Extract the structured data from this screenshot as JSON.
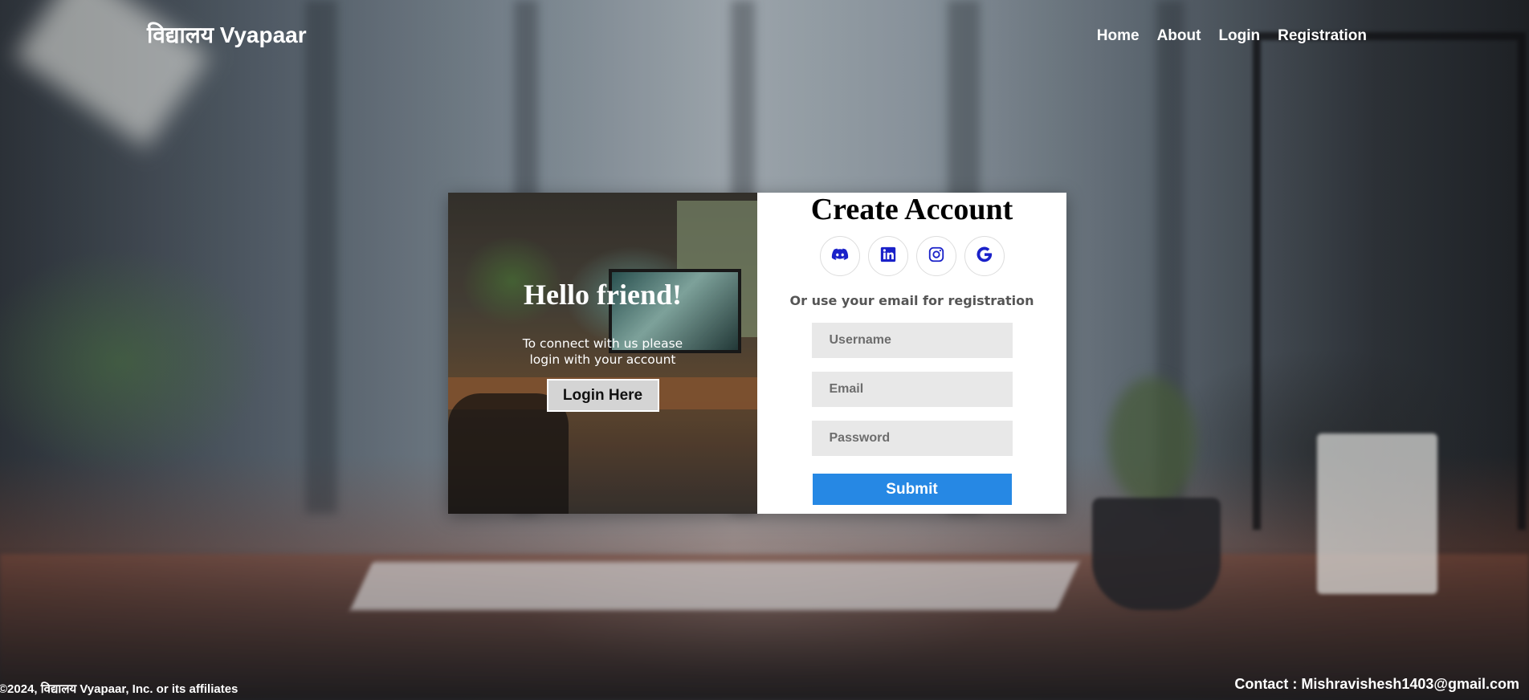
{
  "brand": {
    "name": "विद्यालय Vyapaar"
  },
  "nav": {
    "items": [
      {
        "label": "Home"
      },
      {
        "label": "About"
      },
      {
        "label": "Login"
      },
      {
        "label": "Registration"
      }
    ]
  },
  "welcome_panel": {
    "heading": "Hello friend!",
    "message": "To connect with us please login with your account",
    "login_button_label": "Login Here"
  },
  "register_form": {
    "title": "Create Account",
    "social_icons": [
      "discord-icon",
      "linkedin-icon",
      "instagram-icon",
      "google-icon"
    ],
    "alt_text": "Or use your email for registration",
    "username_placeholder": "Username",
    "email_placeholder": "Email",
    "password_placeholder": "Password",
    "submit_label": "Submit"
  },
  "footer": {
    "copyright": "©2024, विद्यालय Vyapaar, Inc. or its affiliates",
    "contact": "Contact : Mishravishesh1403@gmail.com"
  },
  "colors": {
    "accent": "#2688e4",
    "social_icon": "#1a21c9",
    "input_bg": "#e8e8e8"
  }
}
